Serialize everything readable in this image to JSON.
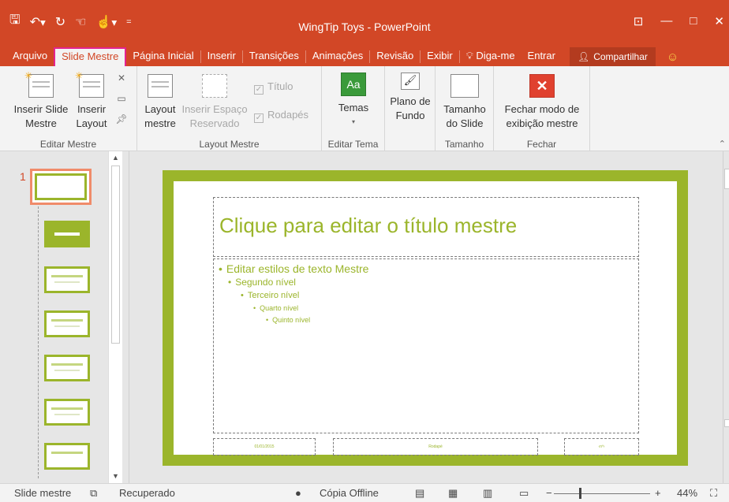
{
  "window": {
    "title": "WingTip Toys - PowerPoint",
    "qat": [
      "save-icon",
      "undo-icon",
      "redo-icon",
      "touch-mode-icon",
      "customize-icon"
    ],
    "controls": [
      "ribbon-display-options-icon",
      "minimize-icon",
      "maximize-icon",
      "close-icon"
    ],
    "accent_color": "#d24726",
    "highlight_color": "#e3238f"
  },
  "tabs": [
    {
      "label": "Arquivo"
    },
    {
      "label": "Slide Mestre",
      "active": true
    },
    {
      "label": "Página Inicial"
    },
    {
      "label": "Inserir"
    },
    {
      "label": "Transições"
    },
    {
      "label": "Animações"
    },
    {
      "label": "Revisão"
    },
    {
      "label": "Exibir"
    },
    {
      "label": "Diga-me"
    },
    {
      "label": "Entrar"
    },
    {
      "label": "Compartilhar"
    }
  ],
  "ribbon": {
    "groups": {
      "editar_mestre": {
        "label": "Editar Mestre",
        "inserir_slide_mestre": "Inserir Slide\nMestre",
        "inserir_layout": "Inserir\nLayout"
      },
      "layout_mestre": {
        "label": "Layout Mestre",
        "layout_mestre": "Layout\nmestre",
        "inserir_espaco": "Inserir Espaço\nReservado",
        "titulo": "Título",
        "rodapes": "Rodapés"
      },
      "editar_tema": {
        "label": "Editar Tema",
        "temas": "Temas",
        "temas_icon_text": "Aa"
      },
      "plano_fundo": {
        "plano_de_fundo": "Plano de\nFundo"
      },
      "tamanho": {
        "label": "Tamanho",
        "tamanho_do_slide": "Tamanho\ndo Slide"
      },
      "fechar": {
        "label": "Fechar",
        "fechar_modo": "Fechar modo de\nexibição mestre"
      }
    }
  },
  "thumbnails": {
    "selected_number": "1",
    "layout_count": 6
  },
  "slide": {
    "title_placeholder": "Clique para editar o título mestre",
    "body_levels": [
      "Editar estilos de texto Mestre",
      "Segundo nível",
      "Terceiro nível",
      "Quarto nível",
      "Quinto nível"
    ],
    "footer_left": "01/01/2015",
    "footer_center": "Rodapé",
    "footer_right": "‹nº›",
    "theme_color": "#9bb52b"
  },
  "statusbar": {
    "view": "Slide mestre",
    "recovered": "Recuperado",
    "offline": "Cópia Offline",
    "zoom": "44%",
    "zoom_level": 0.44
  }
}
